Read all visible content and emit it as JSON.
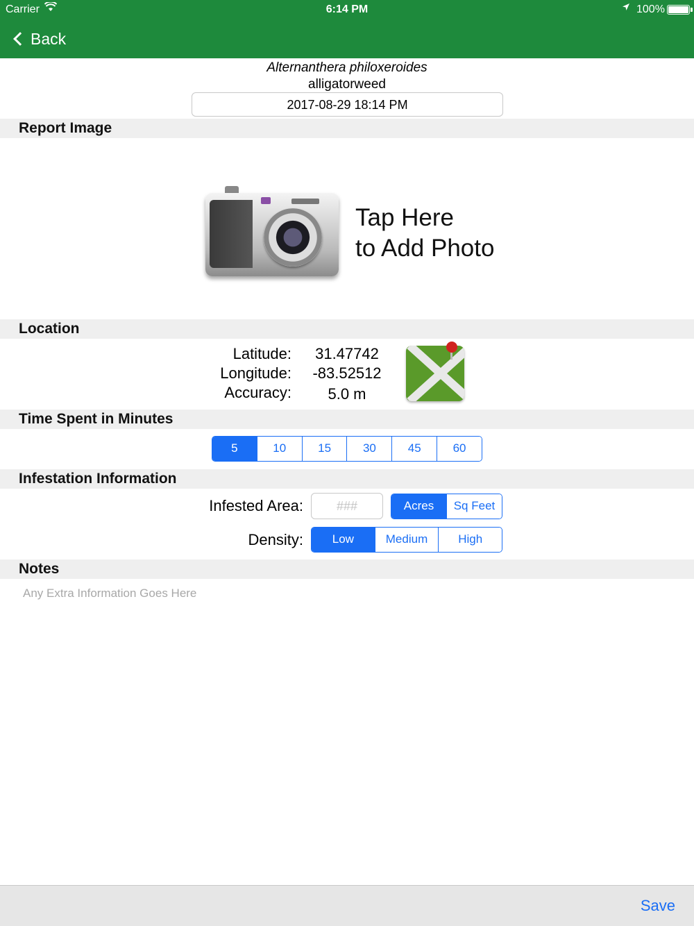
{
  "status_bar": {
    "carrier": "Carrier",
    "time": "6:14 PM",
    "battery": "100%"
  },
  "nav": {
    "back_label": "Back"
  },
  "header": {
    "scientific_name": "Alternanthera philoxeroides",
    "common_name": "alligatorweed",
    "datetime": "2017-08-29 18:14 PM"
  },
  "sections": {
    "report_image": "Report Image",
    "location": "Location",
    "time_spent": "Time Spent in Minutes",
    "infestation": "Infestation Information",
    "notes": "Notes"
  },
  "photo": {
    "line1": "Tap Here",
    "line2": "to Add Photo"
  },
  "location": {
    "latitude_label": "Latitude:",
    "latitude": "31.47742",
    "longitude_label": "Longitude:",
    "longitude": "-83.52512",
    "accuracy_label": "Accuracy:",
    "accuracy": "5.0 m"
  },
  "time_spent": {
    "options": [
      "5",
      "10",
      "15",
      "30",
      "45",
      "60"
    ],
    "selected": "5"
  },
  "infestation": {
    "area_label": "Infested Area:",
    "area_placeholder": "###",
    "area_value": "",
    "units": [
      "Acres",
      "Sq Feet"
    ],
    "selected_unit": "Acres",
    "density_label": "Density:",
    "density_options": [
      "Low",
      "Medium",
      "High"
    ],
    "selected_density": "Low"
  },
  "notes": {
    "placeholder": "Any Extra Information Goes Here"
  },
  "toolbar": {
    "save_label": "Save"
  },
  "colors": {
    "nav_green": "#1e8a3c",
    "accent_blue": "#1a6ef5",
    "section_bg": "#efefef"
  },
  "icons": {
    "back": "chevron-left-icon",
    "camera": "camera-icon",
    "map": "map-pin-icon",
    "wifi": "wifi-icon",
    "location": "location-arrow-icon",
    "battery": "battery-icon"
  }
}
